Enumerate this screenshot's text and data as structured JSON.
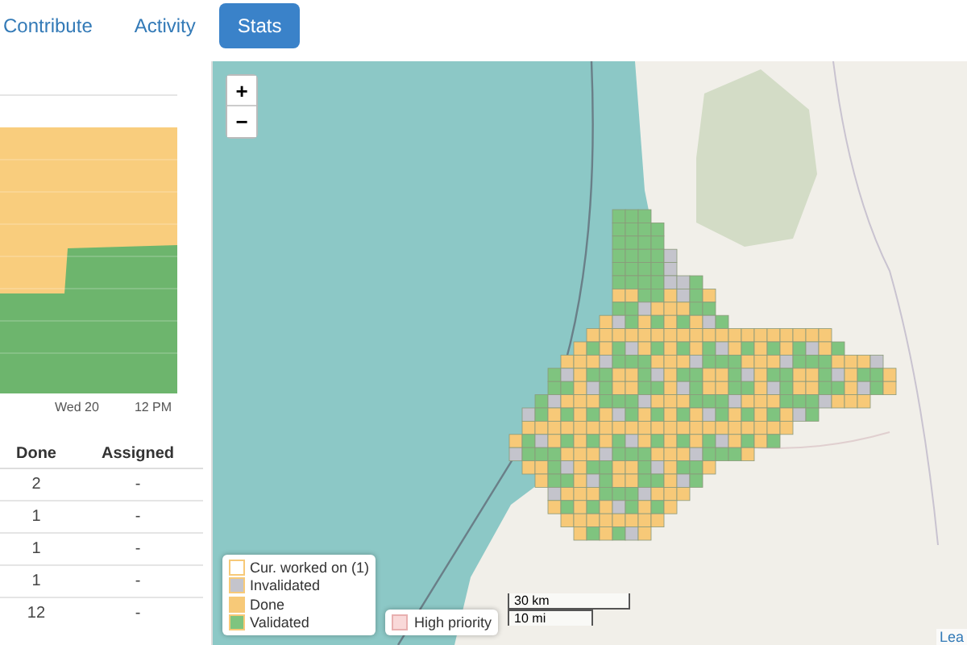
{
  "tabs": [
    {
      "label": "Contribute",
      "selected": false
    },
    {
      "label": "Activity",
      "selected": false
    },
    {
      "label": "Stats",
      "selected": true
    }
  ],
  "progress_chart": {
    "x_labels": [
      "Wed 20",
      "12 PM"
    ]
  },
  "table": {
    "columns": [
      "Done",
      "Assigned"
    ],
    "rows": [
      [
        "2",
        "-"
      ],
      [
        "1",
        "-"
      ],
      [
        "1",
        "-"
      ],
      [
        "1",
        "-"
      ],
      [
        "12",
        "-"
      ]
    ]
  },
  "map": {
    "zoom_in": "+",
    "zoom_out": "−",
    "legend": [
      {
        "label": "Cur. worked on (1)",
        "color": "#ffffff"
      },
      {
        "label": "Invalidated",
        "color": "#c4c4cc"
      },
      {
        "label": "Done",
        "color": "#f7c978"
      },
      {
        "label": "Validated",
        "color": "#7fc47f"
      }
    ],
    "priority_legend": {
      "label": "High priority",
      "color": "#f9d9d9"
    },
    "scale": [
      "30 km",
      "10 mi"
    ],
    "attribution": "Lea"
  }
}
